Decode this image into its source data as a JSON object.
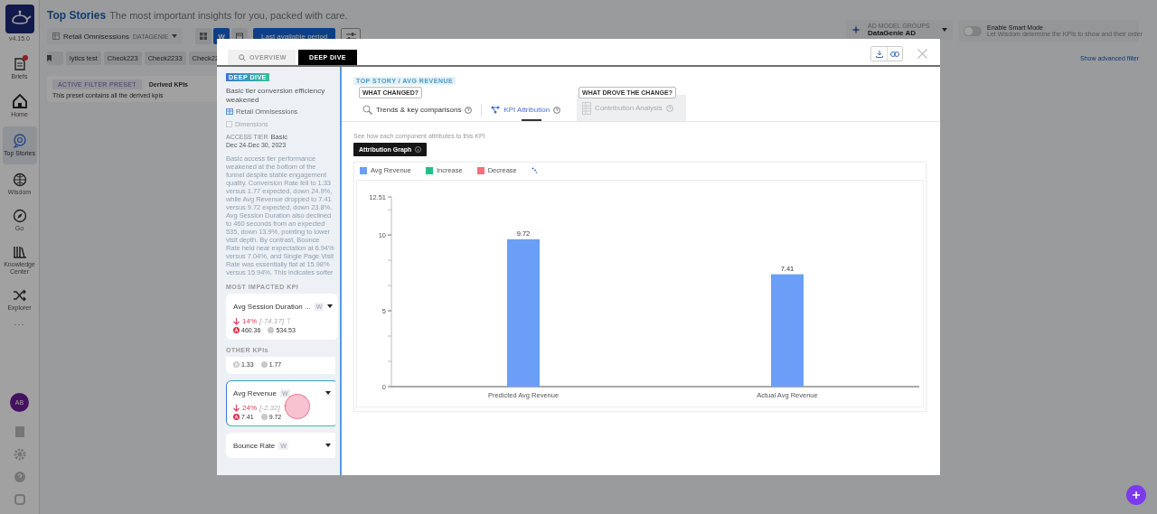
{
  "app": {
    "version": "v4.15.0",
    "title": "Top Stories",
    "subtitle": "The most important insights for you, packed with care."
  },
  "sidebar": {
    "items": [
      {
        "label": "Briefs",
        "kind": "briefs",
        "notification": true,
        "selected": false
      },
      {
        "label": "Home",
        "kind": "home",
        "notification": false,
        "selected": false
      },
      {
        "label": "Top Stories",
        "kind": "stories",
        "notification": false,
        "selected": true
      },
      {
        "label": "Wisdom",
        "kind": "wisdom",
        "notification": false,
        "selected": false
      },
      {
        "label": "Go",
        "kind": "compass",
        "notification": false,
        "selected": false
      },
      {
        "label": "Knowledge Center",
        "kind": "books",
        "notification": false,
        "selected": false
      },
      {
        "label": "Explorer",
        "kind": "shuffle",
        "notification": false,
        "selected": false
      }
    ],
    "more": "···",
    "avatar": "AB"
  },
  "toolbar": {
    "dataset": "Retail Omnisessions",
    "dataset_source": "DATAGENIE",
    "view_buttons": [
      {
        "kind": "grid",
        "selected": false
      },
      {
        "kind": "text",
        "label": "W",
        "selected": true
      },
      {
        "kind": "calendar",
        "selected": false
      }
    ],
    "period_button": "Last available period",
    "model_group": {
      "label": "AD MODEL GROUPS",
      "value": "DataGenie AD"
    },
    "smart_mode": {
      "label": "Enable Smart Mode",
      "description": "Let Wisdom determine the KPIs to show and their order",
      "on": false
    }
  },
  "filter_chips": [
    "lytics test",
    "Check223",
    "Check2233",
    "Check22"
  ],
  "advanced_filter_link": "Show advanced filter",
  "preset": {
    "label": "ACTIVE FILTER PRESET",
    "name": "Derived KPIs",
    "description": "This preset contains all the derived kpis"
  },
  "modal": {
    "tabs": [
      {
        "label": "OVERVIEW",
        "kind": "search",
        "selected": false
      },
      {
        "label": "DEEP DIVE",
        "kind": "plain",
        "selected": true
      }
    ],
    "story": {
      "badge": "DEEP DIVE",
      "title": "Basic tier conversion efficiency weakened",
      "dataset": "Retail Omnisessions",
      "dimensions": "Dimensions",
      "access_tier_label": "ACCESS TIER",
      "access_tier": "Basic",
      "date_range": "Dec 24-Dec 30, 2023",
      "summary": "Basic access tier performance weakened at the bottom of the funnel despite stable engagement quality. Conversion Rate fell to 1.33 versus 1.77 expected, down 24.9%, while Avg Revenue dropped to 7.41 versus 9.72 expected, down 23.8%. Avg Session Duration also declined to 460 seconds from an expected 535, down 13.9%, pointing to lower visit depth. By contrast, Bounce Rate held near expectation at 6.94% versus 7.04%, and Single Page Visit Rate was essentially flat at 15.98% versus 15.94%. This indicates softer"
    },
    "most_impacted_label": "MOST IMPACTED KPI",
    "most_impacted": {
      "kind": "full",
      "name": "Avg Session Duration ...",
      "granularity": "W",
      "change": "14%",
      "delta": "[-74.17]",
      "actual": "460.36",
      "expected": "534.53",
      "anomaly": true,
      "selected": false
    },
    "other_label": "OTHER KPIs",
    "other_kpis": [
      {
        "kind": "values",
        "actual": "1.33",
        "expected": "1.77",
        "anomaly": false,
        "selected": false
      },
      {
        "kind": "full",
        "name": "Avg Revenue",
        "granularity": "W",
        "change": "24%",
        "delta": "[-2.32]",
        "actual": "7.41",
        "expected": "9.72",
        "anomaly": true,
        "selected": true
      },
      {
        "kind": "header",
        "name": "Bounce Rate",
        "granularity": "W",
        "selected": false
      }
    ]
  },
  "analysis": {
    "breadcrumb": "TOP STORY / AVG REVENUE",
    "groups": [
      {
        "label": "WHAT CHANGED?",
        "tabs": [
          {
            "label": "Trends & key comparisons",
            "kind": "magnifier",
            "selected": false,
            "disabled": false
          },
          {
            "label": "KPI Attribution",
            "kind": "graph",
            "selected": true,
            "disabled": false
          }
        ]
      },
      {
        "label": "WHAT DROVE THE CHANGE?",
        "tabs": [
          {
            "label": "Contribution Analysis",
            "kind": "table",
            "selected": false,
            "disabled": true
          }
        ]
      }
    ],
    "hint": "See how each component attributes to this KPI",
    "graph_button": "Attribution Graph",
    "legend": [
      {
        "label": "Avg Revenue",
        "color": "#6b9ff7"
      },
      {
        "label": "Increase",
        "color": "#24c08b"
      },
      {
        "label": "Decrease",
        "color": "#f0707e"
      }
    ],
    "loading": true,
    "chart_data": {
      "type": "bar",
      "categories": [
        "Predicted Avg Revenue",
        "Actual Avg Revenue"
      ],
      "values": [
        9.72,
        7.41
      ],
      "ylim": [
        0,
        12.51
      ],
      "yticks": [
        0,
        5,
        10,
        12.51
      ],
      "data_labels": true
    }
  }
}
